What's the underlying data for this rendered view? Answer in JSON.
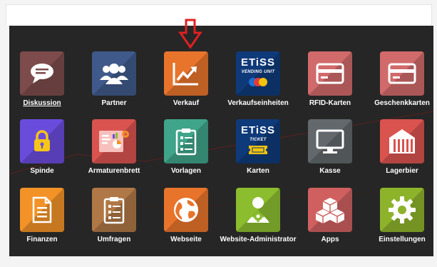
{
  "apps": [
    {
      "key": "diskussion",
      "label": "Diskussion",
      "color": "#7d4b4b",
      "icon": "chat-bubble-icon"
    },
    {
      "key": "partner",
      "label": "Partner",
      "color": "#3f5a8a",
      "icon": "users-icon"
    },
    {
      "key": "verkauf",
      "label": "Verkauf",
      "color": "#e8742c",
      "icon": "trend-chart-icon"
    },
    {
      "key": "verkaufseinheiten",
      "label": "Verkaufseinheiten",
      "color": "#0f3a79",
      "icon": "etiss-vending-icon",
      "logo": "ETiSS",
      "sub": "VENDING UNIT"
    },
    {
      "key": "rfid",
      "label": "RFID-Karten",
      "color": "#d16a6a",
      "icon": "card-icon"
    },
    {
      "key": "geschenkkarten",
      "label": "Geschenkkarten",
      "color": "#d16a6a",
      "icon": "card-icon"
    },
    {
      "key": "spinde",
      "label": "Spinde",
      "color": "#6a4cdc",
      "icon": "lock-icon"
    },
    {
      "key": "armaturenbrett",
      "label": "Armaturenbrett",
      "color": "#d9534f",
      "icon": "dashboard-icon"
    },
    {
      "key": "vorlagen",
      "label": "Vorlagen",
      "color": "#3fa48a",
      "icon": "clipboard-icon"
    },
    {
      "key": "karten",
      "label": "Karten",
      "color": "#0f3a79",
      "icon": "etiss-ticket-icon",
      "logo": "ETiSS",
      "sub": "TICKET"
    },
    {
      "key": "kasse",
      "label": "Kasse",
      "color": "#62686b",
      "icon": "monitor-icon"
    },
    {
      "key": "lagerbier",
      "label": "Lagerbier",
      "color": "#d9534f",
      "icon": "warehouse-icon"
    },
    {
      "key": "finanzen",
      "label": "Finanzen",
      "color": "#f29227",
      "icon": "document-icon"
    },
    {
      "key": "umfragen",
      "label": "Umfragen",
      "color": "#b07846",
      "icon": "clipboard-icon"
    },
    {
      "key": "webseite",
      "label": "Webseite",
      "color": "#e8742c",
      "icon": "globe-icon"
    },
    {
      "key": "website_admin",
      "label": "Website-Administrator",
      "color": "#8bbd2f",
      "icon": "admin-user-icon"
    },
    {
      "key": "apps",
      "label": "Apps",
      "color": "#d06060",
      "icon": "cubes-icon"
    },
    {
      "key": "einstellungen",
      "label": "Einstellungen",
      "color": "#8db32b",
      "icon": "gear-icon"
    }
  ],
  "annotation": {
    "arrow_color": "#e02020",
    "icon": "red-down-arrow-icon"
  }
}
